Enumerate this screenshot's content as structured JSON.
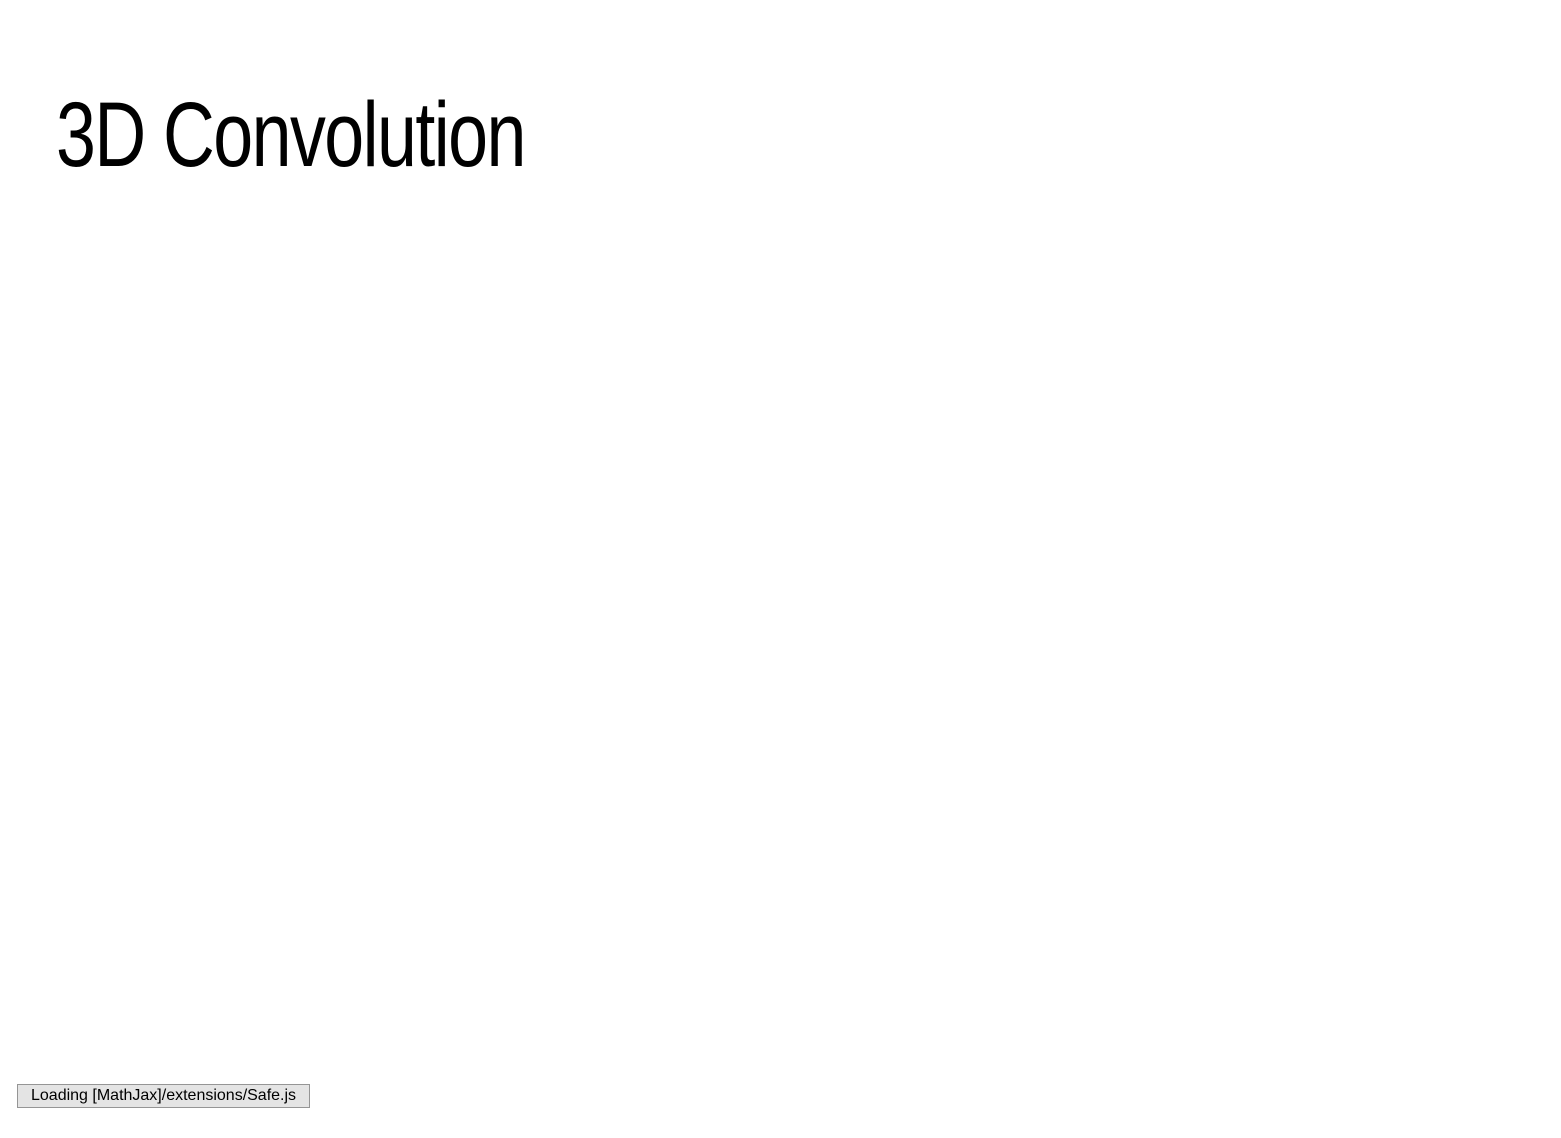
{
  "page": {
    "title": "3D Convolution"
  },
  "status": {
    "message": "Loading [MathJax]/extensions/Safe.js"
  },
  "colors": {
    "background": "#ffffff",
    "text": "#000000",
    "status_background": "#e4e4e4",
    "status_border": "#959595"
  }
}
